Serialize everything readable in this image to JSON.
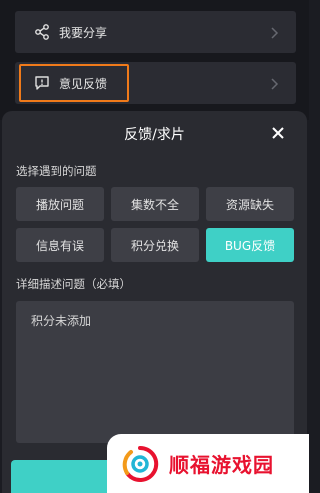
{
  "menu": {
    "share_label": "我要分享",
    "feedback_label": "意见反馈",
    "share_icon": "share-icon",
    "feedback_icon": "message-alert-icon",
    "chevron_icon": "chevron-right-icon"
  },
  "sheet": {
    "title": "反馈/求片",
    "issue_section_label": "选择遇到的问题",
    "options": [
      {
        "label": "播放问题",
        "selected": false
      },
      {
        "label": "集数不全",
        "selected": false
      },
      {
        "label": "资源缺失",
        "selected": false
      },
      {
        "label": "信息有误",
        "selected": false
      },
      {
        "label": "积分兑换",
        "selected": false
      },
      {
        "label": "BUG反馈",
        "selected": true
      }
    ],
    "detail_section_label": "详细描述问题（必填）",
    "detail_text": "积分未添加"
  },
  "watermark": {
    "text": "顺福游戏园"
  },
  "colors": {
    "accent": "#3fd0c6",
    "highlight": "#f07a1a",
    "watermark_red": "#e8122f"
  }
}
